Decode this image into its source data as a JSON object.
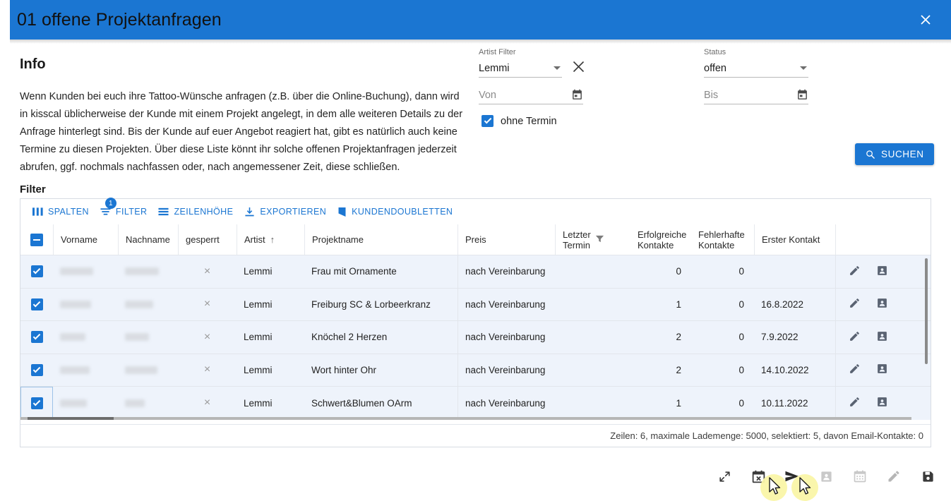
{
  "window": {
    "title": "01 offene Projektanfragen",
    "close_icon": "close-icon"
  },
  "info": {
    "heading": "Info",
    "text": "Wenn Kunden bei euch ihre Tattoo-Wünsche anfragen (z.B. über die Online-Buchung), dann wird in kisscal üblicherweise der Kunde mit einem Projekt angelegt, in dem alle weiteren Details zu der Anfrage hinterlegt sind. Bis der Kunde auf euer Angebot reagiert hat, gibt es natürlich auch keine Termine zu diesen Projekten. Über diese Liste könnt ihr solche offenen Projektanfragen jederzeit abrufen, ggf. nochmals nachfassen oder, nach angemessener Zeit, diese schließen."
  },
  "filters": {
    "artist": {
      "label": "Artist Filter",
      "value": "Lemmi"
    },
    "status": {
      "label": "Status",
      "value": "offen"
    },
    "von": {
      "label": "",
      "placeholder": "Von",
      "value": ""
    },
    "bis": {
      "label": "",
      "placeholder": "Bis",
      "value": ""
    },
    "ohne_termin": {
      "label": "ohne Termin",
      "checked": true
    },
    "clear_icon": "close-icon",
    "search_button": "SUCHEN"
  },
  "grid": {
    "section_title": "Filter",
    "toolbar": [
      {
        "label": "SPALTEN",
        "icon": "columns-icon",
        "badge": ""
      },
      {
        "label": "FILTER",
        "icon": "filter-icon",
        "badge": "1"
      },
      {
        "label": "ZEILENHÖHE",
        "icon": "row-height-icon",
        "badge": ""
      },
      {
        "label": "EXPORTIEREN",
        "icon": "download-icon",
        "badge": ""
      },
      {
        "label": "KUNDENDOUBLETTEN",
        "icon": "bookmark-icon",
        "badge": ""
      }
    ],
    "columns": [
      "Vorname",
      "Nachname",
      "gesperrt",
      "Artist",
      "Projektname",
      "Preis",
      "Letzter Termin",
      "Erfolgreiche Kontakte",
      "Fehlerhafte Kontakte",
      "Erster Kontakt"
    ],
    "sort_column": "Artist",
    "sort_direction": "↑",
    "select_all_state": "indeterminate",
    "rows": [
      {
        "selected": true,
        "vorname": "",
        "nachname": "",
        "gesperrt": "×",
        "artist": "Lemmi",
        "projektname": "Frau mit Ornamente",
        "preis": "nach Vereinbarung",
        "letzter_termin": "",
        "erfolgreiche": "0",
        "fehlerhafte": "0",
        "erster_kontakt": ""
      },
      {
        "selected": true,
        "vorname": "",
        "nachname": "",
        "gesperrt": "×",
        "artist": "Lemmi",
        "projektname": "Freiburg SC & Lorbeerkranz",
        "preis": "nach Vereinbarung",
        "letzter_termin": "",
        "erfolgreiche": "1",
        "fehlerhafte": "0",
        "erster_kontakt": "16.8.2022"
      },
      {
        "selected": true,
        "vorname": "",
        "nachname": "",
        "gesperrt": "×",
        "artist": "Lemmi",
        "projektname": "Knöchel 2 Herzen",
        "preis": "nach Vereinbarung",
        "letzter_termin": "",
        "erfolgreiche": "2",
        "fehlerhafte": "0",
        "erster_kontakt": "7.9.2022"
      },
      {
        "selected": true,
        "vorname": "",
        "nachname": "",
        "gesperrt": "×",
        "artist": "Lemmi",
        "projektname": "Wort hinter Ohr",
        "preis": "nach Vereinbarung",
        "letzter_termin": "",
        "erfolgreiche": "2",
        "fehlerhafte": "0",
        "erster_kontakt": "14.10.2022"
      },
      {
        "selected": true,
        "vorname": "",
        "nachname": "",
        "gesperrt": "×",
        "artist": "Lemmi",
        "projektname": "Schwert&Blumen OArm",
        "preis": "nach Vereinbarung",
        "letzter_termin": "",
        "erfolgreiche": "1",
        "fehlerhafte": "0",
        "erster_kontakt": "10.11.2022"
      }
    ],
    "row_action_icons": [
      "edit-pencil-icon",
      "contact-card-icon"
    ],
    "status_text": "Zeilen: 6, maximale Lademenge: 5000, selektiert: 5, davon Email-Kontakte: 0"
  },
  "bottom_toolbar": [
    {
      "name": "expand-icon",
      "enabled": true
    },
    {
      "name": "calendar-cancel-icon",
      "enabled": true
    },
    {
      "name": "send-icon",
      "enabled": true
    },
    {
      "name": "contact-card-icon",
      "enabled": false
    },
    {
      "name": "calendar-icon",
      "enabled": false
    },
    {
      "name": "edit-pencil-icon",
      "enabled": false
    },
    {
      "name": "save-icon",
      "enabled": true
    }
  ],
  "colors": {
    "accent": "#1b76d2",
    "row_tint": "#eef3fb",
    "title_text": "#111111"
  }
}
